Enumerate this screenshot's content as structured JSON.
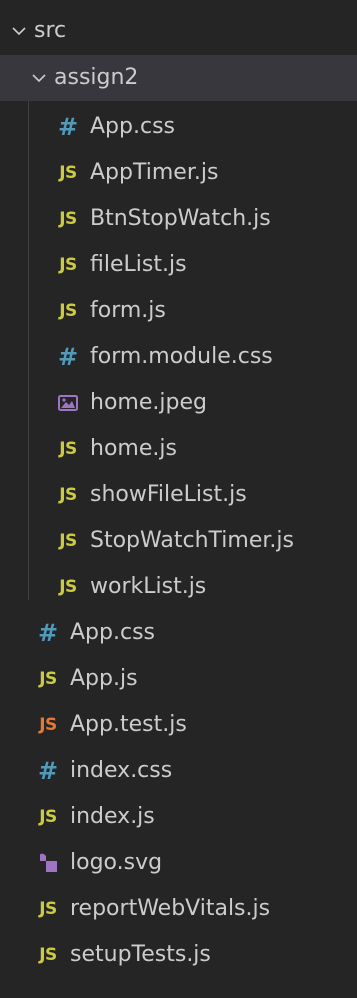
{
  "explorer": {
    "root": {
      "label": "src",
      "expanded": true
    },
    "folder": {
      "label": "assign2",
      "expanded": true
    },
    "folder_files": [
      {
        "label": "App.css",
        "icon": "css-icon"
      },
      {
        "label": "AppTimer.js",
        "icon": "js-icon"
      },
      {
        "label": "BtnStopWatch.js",
        "icon": "js-icon"
      },
      {
        "label": "fileList.js",
        "icon": "js-icon"
      },
      {
        "label": "form.js",
        "icon": "js-icon"
      },
      {
        "label": "form.module.css",
        "icon": "css-icon"
      },
      {
        "label": "home.jpeg",
        "icon": "image-icon"
      },
      {
        "label": "home.js",
        "icon": "js-icon"
      },
      {
        "label": "showFileList.js",
        "icon": "js-icon"
      },
      {
        "label": "StopWatchTimer.js",
        "icon": "js-icon"
      },
      {
        "label": "workList.js",
        "icon": "js-icon"
      }
    ],
    "root_files": [
      {
        "label": "App.css",
        "icon": "css-icon"
      },
      {
        "label": "App.js",
        "icon": "js-icon"
      },
      {
        "label": "App.test.js",
        "icon": "js-test-icon"
      },
      {
        "label": "index.css",
        "icon": "css-icon"
      },
      {
        "label": "index.js",
        "icon": "js-icon"
      },
      {
        "label": "logo.svg",
        "icon": "svg-icon"
      },
      {
        "label": "reportWebVitals.js",
        "icon": "js-icon"
      },
      {
        "label": "setupTests.js",
        "icon": "js-icon"
      }
    ],
    "icon_glyphs": {
      "js": "JS",
      "css": "#"
    },
    "colors": {
      "background": "#252526",
      "selected": "#37373d",
      "text": "#cccccc",
      "js": "#cbcb41",
      "js_test": "#e37933",
      "css": "#519aba",
      "image": "#a074c4",
      "svg": "#a074c4"
    }
  }
}
